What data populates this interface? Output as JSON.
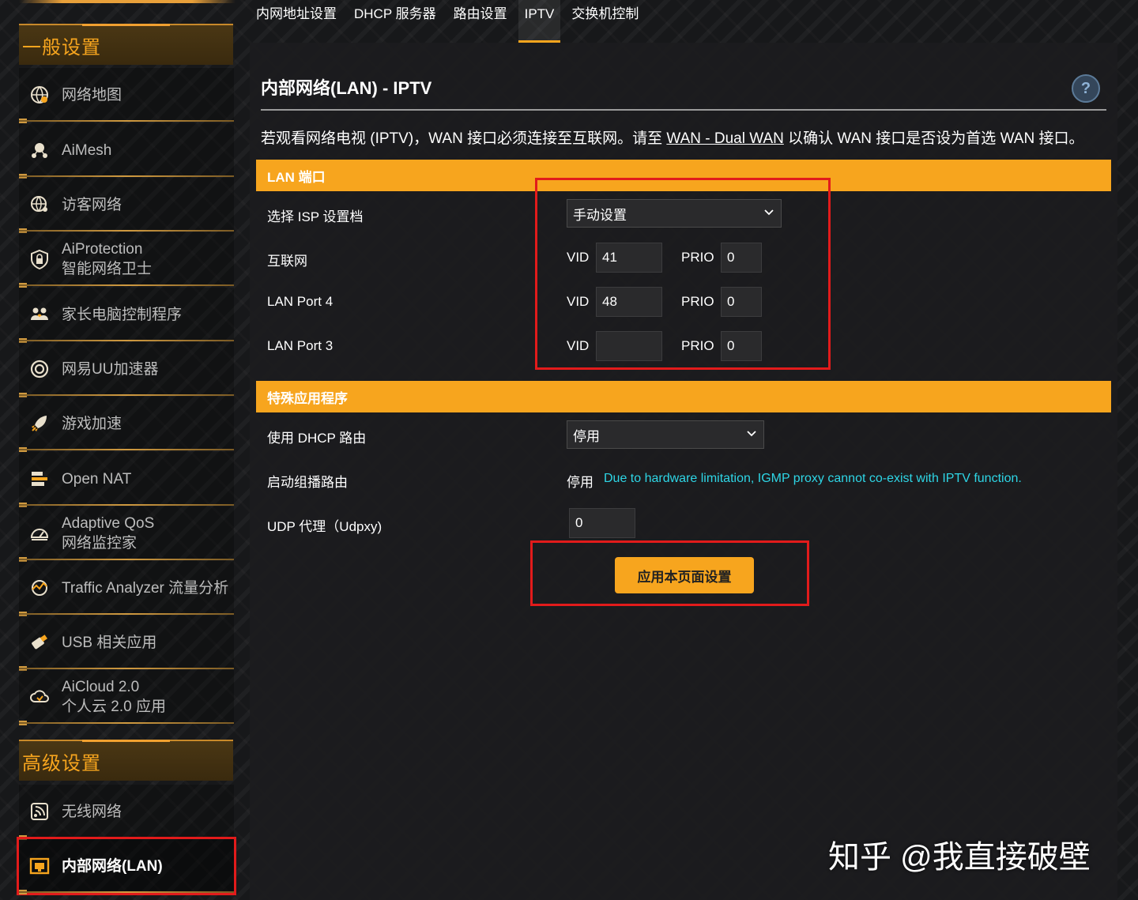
{
  "sidebar": {
    "general_header": "一般设置",
    "advanced_header": "高级设置",
    "items": [
      {
        "icon": "globe-map-icon",
        "lines": [
          "网络地图"
        ]
      },
      {
        "icon": "aimesh-icon",
        "lines": [
          "AiMesh"
        ]
      },
      {
        "icon": "guest-network-icon",
        "lines": [
          "访客网络"
        ]
      },
      {
        "icon": "shield-lock-icon",
        "lines": [
          "AiProtection",
          "智能网络卫士"
        ]
      },
      {
        "icon": "family-icon",
        "lines": [
          "家长电脑控制程序"
        ]
      },
      {
        "icon": "uu-accelerator-icon",
        "lines": [
          "网易UU加速器"
        ]
      },
      {
        "icon": "rocket-icon",
        "lines": [
          "游戏加速"
        ]
      },
      {
        "icon": "nat-icon",
        "lines": [
          "Open NAT"
        ]
      },
      {
        "icon": "gauge-icon",
        "lines": [
          "Adaptive QoS",
          "网络监控家"
        ]
      },
      {
        "icon": "traffic-icon",
        "lines": [
          "Traffic Analyzer 流量分析"
        ]
      },
      {
        "icon": "usb-icon",
        "lines": [
          "USB 相关应用"
        ]
      },
      {
        "icon": "cloud-icon",
        "lines": [
          "AiCloud 2.0",
          "个人云 2.0 应用"
        ]
      },
      {
        "icon": "wireless-icon",
        "lines": [
          "无线网络"
        ]
      },
      {
        "icon": "lan-icon",
        "lines": [
          "内部网络(LAN)"
        ]
      }
    ]
  },
  "tabs": [
    "内网地址设置",
    "DHCP 服务器",
    "路由设置",
    "IPTV",
    "交换机控制"
  ],
  "main": {
    "title": "内部网络(LAN) - IPTV",
    "help": "?",
    "description_pre": "若观看网络电视 (IPTV)，WAN 接口必须连接至互联网。请至 ",
    "description_link": "WAN - Dual WAN",
    "description_post": " 以确认 WAN 接口是否设为首选 WAN 接口。",
    "lan_section": "LAN 端口",
    "isp_label": "选择 ISP 设置档",
    "isp_value": "手动设置",
    "vid_label": "VID",
    "prio_label": "PRIO",
    "rows": [
      {
        "label": "互联网",
        "vid": "41",
        "prio": "0"
      },
      {
        "label": "LAN Port 4",
        "vid": "48",
        "prio": "0"
      },
      {
        "label": "LAN Port 3",
        "vid": "",
        "prio": "0"
      }
    ],
    "special_section": "特殊应用程序",
    "dhcp_label": "使用 DHCP 路由",
    "dhcp_value": "停用",
    "multicast_label": "启动组播路由",
    "multicast_value": "停用",
    "multicast_note": "Due to hardware limitation, IGMP proxy cannot co-exist with IPTV function.",
    "udpxy_label": "UDP 代理（Udpxy)",
    "udpxy_value": "0",
    "apply_label": "应用本页面设置"
  },
  "watermark": "知乎 @我直接破壁"
}
